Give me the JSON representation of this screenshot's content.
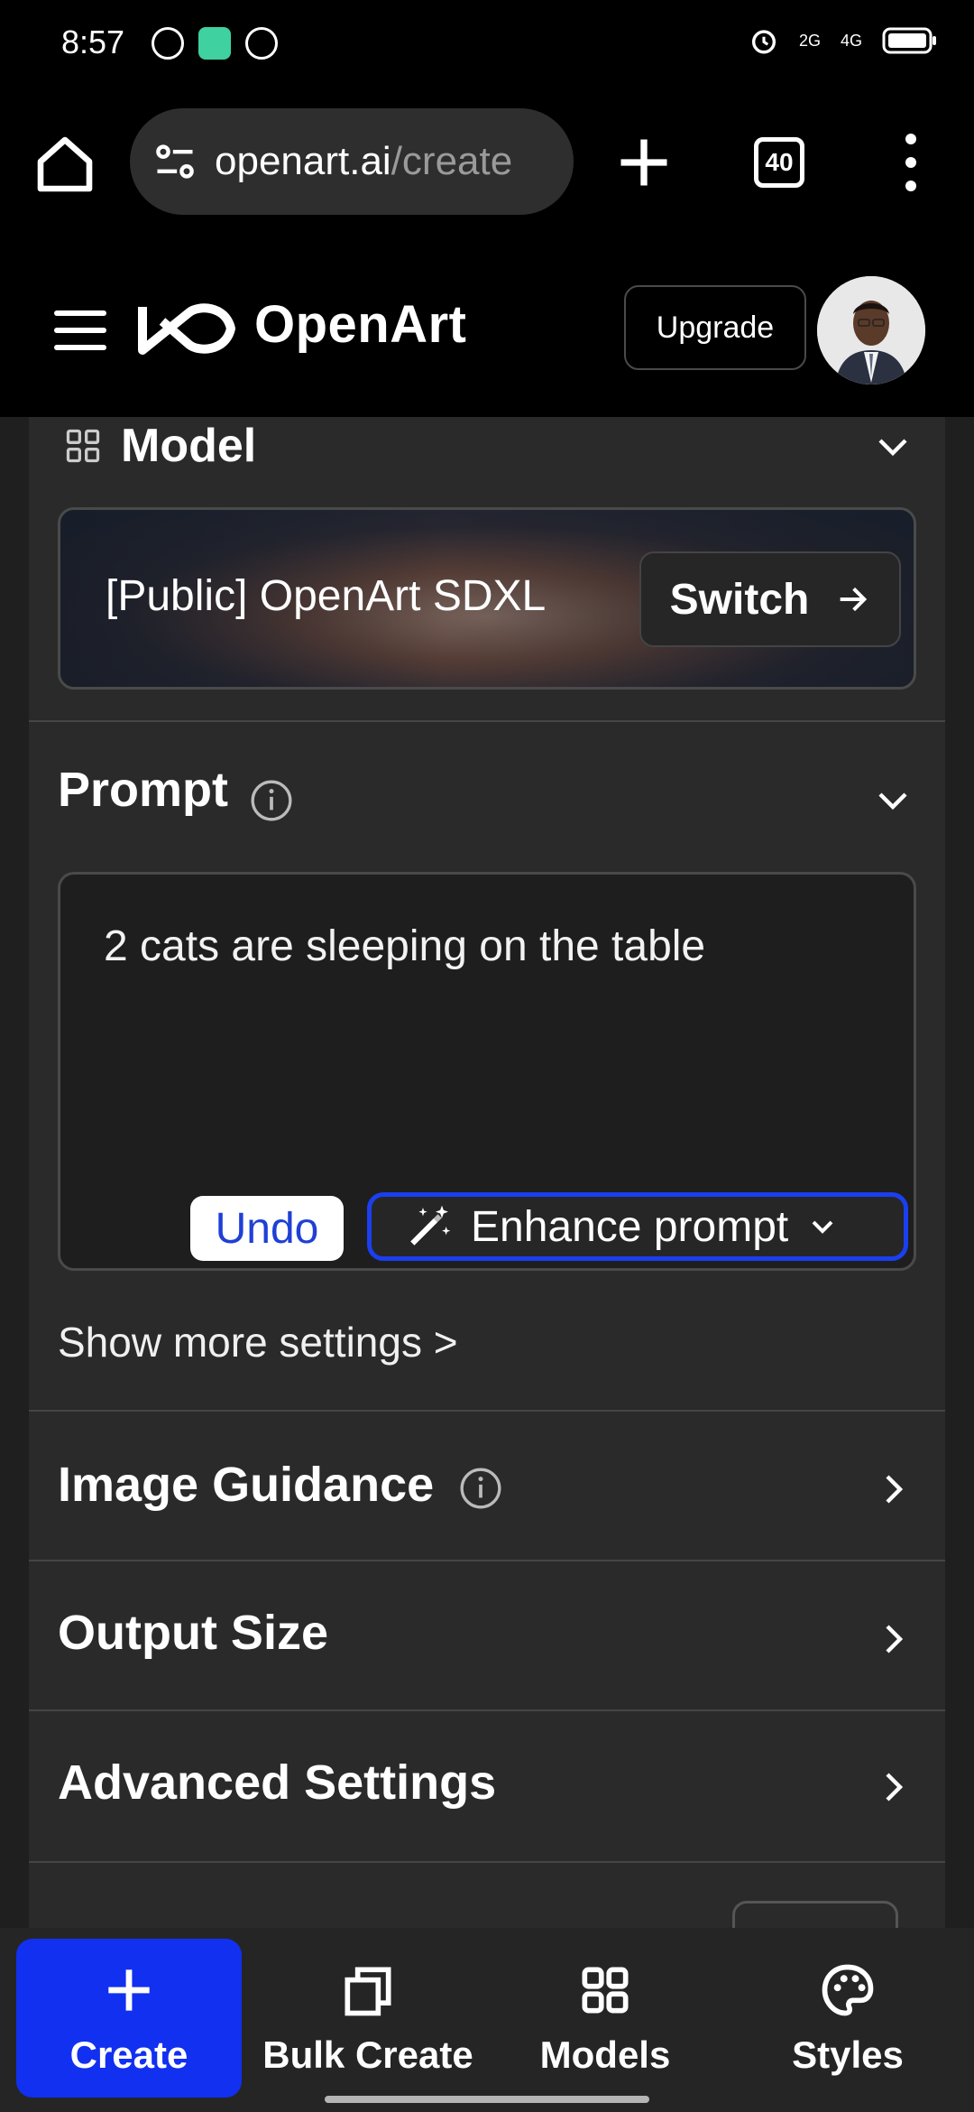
{
  "status_bar": {
    "time": "8:57",
    "network_1": "2G",
    "network_2": "4G"
  },
  "browser": {
    "url_domain": "openart.ai",
    "url_path": "/create",
    "tab_count": "40"
  },
  "header": {
    "logo_text": "OpenArt",
    "upgrade_label": "Upgrade"
  },
  "model": {
    "section_title": "Model",
    "model_name": "[Public] OpenArt SDXL",
    "switch_label": "Switch"
  },
  "prompt": {
    "section_title": "Prompt",
    "value": "2 cats are sleeping on the table",
    "undo_label": "Undo",
    "enhance_label": "Enhance prompt"
  },
  "more_settings_label": "Show more settings >",
  "sections": {
    "image_guidance": "Image Guidance",
    "output_size": "Output Size",
    "advanced_settings": "Advanced Settings"
  },
  "bottom_nav": {
    "create": "Create",
    "bulk_create": "Bulk Create",
    "models": "Models",
    "styles": "Styles"
  },
  "colors": {
    "accent": "#1230f0",
    "panel": "#2a2a2a",
    "background": "#1f1f1f"
  }
}
